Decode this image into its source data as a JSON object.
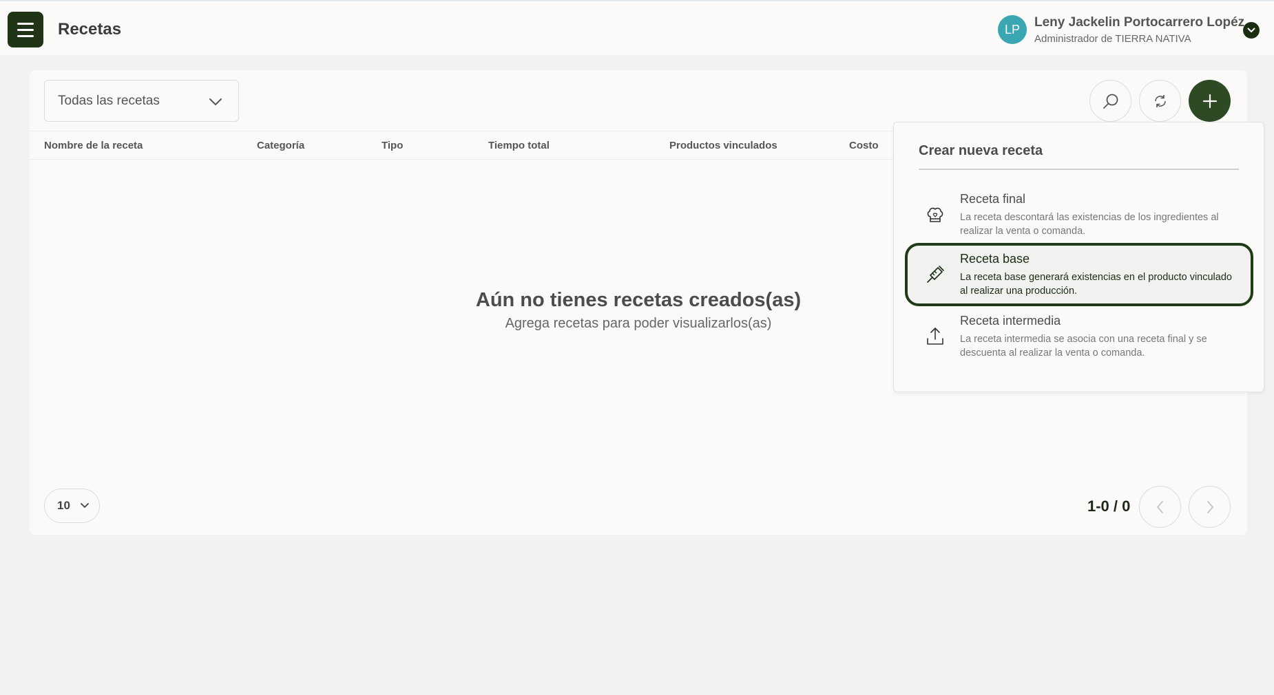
{
  "header": {
    "title": "Recetas",
    "user": {
      "initials": "LP",
      "name": "Leny Jackelin Portocarrero Lopéz",
      "role": "Administrador de TIERRA NATIVA"
    }
  },
  "filter": {
    "selected": "Todas las recetas"
  },
  "table": {
    "columns": [
      "Nombre de la receta",
      "Categoría",
      "Tipo",
      "Tiempo total",
      "Productos vinculados",
      "Costo"
    ]
  },
  "empty_state": {
    "title": "Aún no tienes recetas creados(as)",
    "subtitle": "Agrega recetas para poder visualizarlos(as)"
  },
  "pagination": {
    "page_size": "10",
    "range": "1-0 / 0"
  },
  "dropdown": {
    "title": "Crear nueva receta",
    "items": [
      {
        "title": "Receta final",
        "description": "La receta descontará las existencias de los ingredientes al realizar la venta o comanda.",
        "icon": "chef-hat-icon"
      },
      {
        "title": "Receta base",
        "description": "La receta base generará existencias en el producto vinculado al realizar una producción.",
        "icon": "pen-tool-icon"
      },
      {
        "title": "Receta intermedia",
        "description": "La receta intermedia se asocia con una receta final y se descuenta al realizar la venta o comanda.",
        "icon": "upload-icon"
      }
    ]
  },
  "colors": {
    "primary": "#2e4a25",
    "avatar": "#3aa6b2",
    "background": "#f3f2f0"
  }
}
